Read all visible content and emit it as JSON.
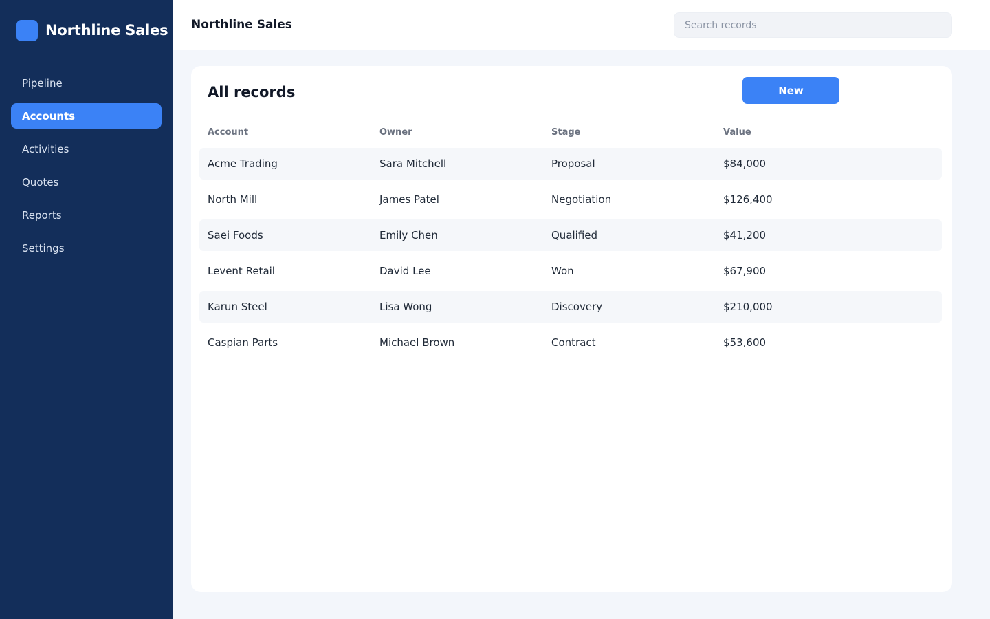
{
  "app": {
    "name": "Northline Sales"
  },
  "sidebar": {
    "items": [
      {
        "label": "Pipeline"
      },
      {
        "label": "Accounts"
      },
      {
        "label": "Activities"
      },
      {
        "label": "Quotes"
      },
      {
        "label": "Reports"
      },
      {
        "label": "Settings"
      }
    ],
    "active": "Accounts"
  },
  "header": {
    "title": "Northline Sales",
    "search_placeholder": "Search records"
  },
  "main": {
    "title": "All records",
    "new_button": "New",
    "columns": [
      "Account",
      "Owner",
      "Stage",
      "Value"
    ],
    "rows": [
      [
        "Acme Trading",
        "Sara Mitchell",
        "Proposal",
        "$84,000"
      ],
      [
        "North Mill",
        "James Patel",
        "Negotiation",
        "$126,400"
      ],
      [
        "Saei Foods",
        "Emily Chen",
        "Qualified",
        "$41,200"
      ],
      [
        "Levent Retail",
        "David Lee",
        "Won",
        "$67,900"
      ],
      [
        "Karun Steel",
        "Lisa Wong",
        "Discovery",
        "$210,000"
      ],
      [
        "Caspian Parts",
        "Michael Brown",
        "Contract",
        "$53,600"
      ]
    ]
  },
  "colors": {
    "sidebar_bg": "#132e5a",
    "accent": "#3b82f6",
    "page_bg": "#f3f6fb",
    "row_stripe": "#f5f7fa"
  }
}
